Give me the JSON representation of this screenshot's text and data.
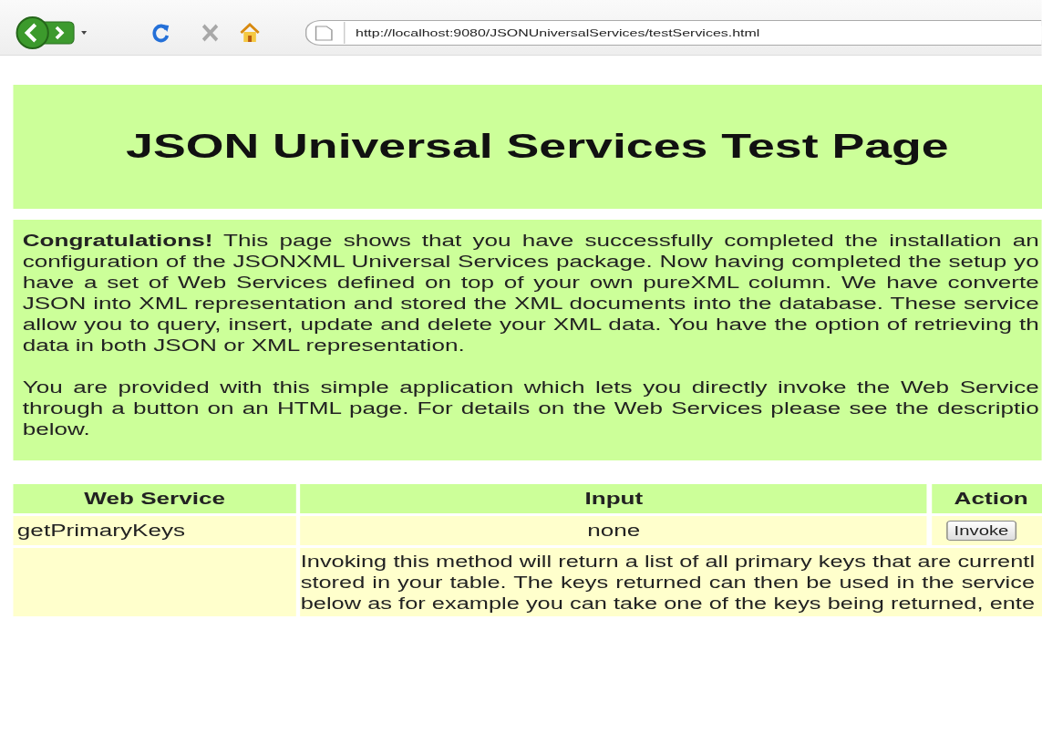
{
  "browser": {
    "address": "http://localhost:9080/JSONUniversalServices/testServices.html"
  },
  "heading": "JSON Universal Services Test Page",
  "intro": [
    {
      "lines": [
        "**Congratulations!** This page shows that you have successfully completed the installation an",
        "configuration of the JSONXML Universal Services package. Now having completed the setup yo",
        "have a set of Web Services defined on top of your own pureXML column. We have converte",
        "JSON into XML representation and stored the XML documents into the database. These service",
        "allow you to query, insert, update and delete your XML data. You have the option of retrieving th",
        "data in both JSON or XML representation."
      ]
    },
    {
      "lines": [
        "You are provided with this simple application which lets you directly invoke the Web Service",
        "through a button on an HTML page. For details on the Web Services please see the descriptio",
        "below."
      ]
    }
  ],
  "table": {
    "columns": [
      "Web Service",
      "Input",
      "Action"
    ],
    "rows": [
      {
        "service": "getPrimaryKeys",
        "input": "none",
        "action": "Invoke",
        "description_lines": [
          "Invoking this method will return a list of all primary keys that are currentl",
          "stored in your table. The keys returned can then be used in the service",
          "below as for example you can take one of the keys being returned, ente"
        ]
      }
    ]
  }
}
